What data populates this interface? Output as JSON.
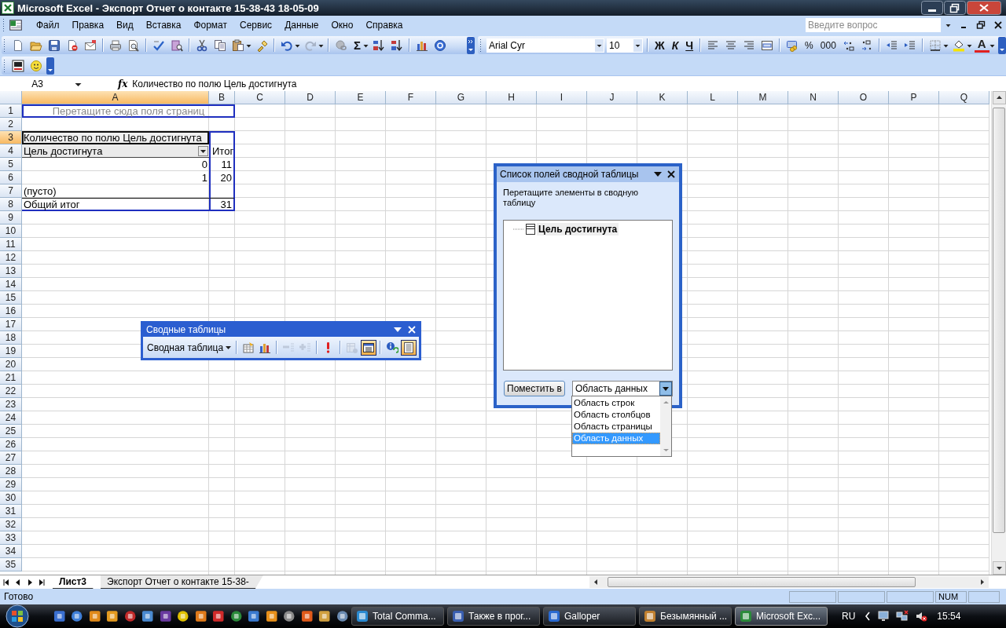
{
  "window": {
    "title": "Microsoft Excel - Экспорт Отчет о контакте 15-38-43 18-05-09"
  },
  "menu": [
    "Файл",
    "Правка",
    "Вид",
    "Вставка",
    "Формат",
    "Сервис",
    "Данные",
    "Окно",
    "Справка"
  ],
  "help_search": {
    "placeholder": "Введите вопрос"
  },
  "standard_toolbar": {
    "sum": "Σ"
  },
  "formatting_toolbar": {
    "font": "Arial Cyr",
    "size": "10",
    "bold": "Ж",
    "italic": "К",
    "underline": "Ч",
    "percent": "%",
    "thousands": "000",
    "font_color": "A"
  },
  "formula_bar": {
    "name_box": "A3",
    "fx": "fx",
    "formula": "Количество по полю Цель достигнута"
  },
  "columns": [
    {
      "label": "A",
      "selected": true
    },
    {
      "label": "B",
      "selected": false
    },
    {
      "label": "C",
      "selected": false
    },
    {
      "label": "D",
      "selected": false
    },
    {
      "label": "E",
      "selected": false
    },
    {
      "label": "F",
      "selected": false
    },
    {
      "label": "G",
      "selected": false
    },
    {
      "label": "H",
      "selected": false
    },
    {
      "label": "I",
      "selected": false
    },
    {
      "label": "J",
      "selected": false
    },
    {
      "label": "K",
      "selected": false
    },
    {
      "label": "L",
      "selected": false
    },
    {
      "label": "M",
      "selected": false
    },
    {
      "label": "N",
      "selected": false
    },
    {
      "label": "O",
      "selected": false
    },
    {
      "label": "P",
      "selected": false
    },
    {
      "label": "Q",
      "selected": false
    }
  ],
  "rows": [
    {
      "header": "1",
      "selected": false,
      "a": {
        "text": "Перетащите сюда поля страниц",
        "kind": "hint"
      }
    },
    {
      "header": "2",
      "selected": false
    },
    {
      "header": "3",
      "selected": true,
      "in_pivot": true,
      "a": {
        "text": "Количество по полю Цель достигнута",
        "kind": "caption"
      }
    },
    {
      "header": "4",
      "selected": false,
      "in_pivot": true,
      "a": {
        "text": "Цель достигнута",
        "kind": "field"
      },
      "b": {
        "text": "Итог",
        "kind": "label"
      }
    },
    {
      "header": "5",
      "selected": false,
      "in_pivot": true,
      "a": {
        "text": "0",
        "kind": "number"
      },
      "b": {
        "text": "11",
        "kind": "number"
      }
    },
    {
      "header": "6",
      "selected": false,
      "in_pivot": true,
      "a": {
        "text": "1",
        "kind": "number"
      },
      "b": {
        "text": "20",
        "kind": "number"
      }
    },
    {
      "header": "7",
      "selected": false,
      "in_pivot": true,
      "a": {
        "text": "(пусто)",
        "kind": "label"
      }
    },
    {
      "header": "8",
      "selected": false,
      "in_pivot": true,
      "total": true,
      "a": {
        "text": "Общий итог",
        "kind": "label"
      },
      "b": {
        "text": "31",
        "kind": "number"
      }
    },
    {
      "header": "9",
      "selected": false
    },
    {
      "header": "10",
      "selected": false
    },
    {
      "header": "11",
      "selected": false
    },
    {
      "header": "12",
      "selected": false
    },
    {
      "header": "13",
      "selected": false
    },
    {
      "header": "14",
      "selected": false
    },
    {
      "header": "15",
      "selected": false
    },
    {
      "header": "16",
      "selected": false
    },
    {
      "header": "17",
      "selected": false
    },
    {
      "header": "18",
      "selected": false
    },
    {
      "header": "19",
      "selected": false
    },
    {
      "header": "20",
      "selected": false
    },
    {
      "header": "21",
      "selected": false
    },
    {
      "header": "22",
      "selected": false
    },
    {
      "header": "23",
      "selected": false
    },
    {
      "header": "24",
      "selected": false
    },
    {
      "header": "25",
      "selected": false
    },
    {
      "header": "26",
      "selected": false
    },
    {
      "header": "27",
      "selected": false
    },
    {
      "header": "28",
      "selected": false
    },
    {
      "header": "29",
      "selected": false
    },
    {
      "header": "30",
      "selected": false
    },
    {
      "header": "31",
      "selected": false
    },
    {
      "header": "32",
      "selected": false
    },
    {
      "header": "33",
      "selected": false
    },
    {
      "header": "34",
      "selected": false
    },
    {
      "header": "35",
      "selected": false
    }
  ],
  "pivot_toolbar": {
    "title": "Сводные таблицы",
    "menu": "Сводная таблица",
    "tools": [
      {
        "pressed": false,
        "disabled": false
      },
      {
        "pressed": false,
        "disabled": false
      },
      {
        "pressed": false,
        "disabled": true
      },
      {
        "pressed": false,
        "disabled": true
      },
      {
        "pressed": false,
        "disabled": false
      },
      {
        "pressed": false,
        "disabled": true
      },
      {
        "pressed": true,
        "disabled": false
      },
      {
        "pressed": false,
        "disabled": false
      },
      {
        "pressed": true,
        "disabled": false
      }
    ]
  },
  "field_list": {
    "title": "Список полей сводной таблицы",
    "instruction": "Перетащите элементы в сводную таблицу",
    "fields": [
      "Цель достигнута"
    ],
    "button": "Поместить в",
    "area": {
      "value": "Область данных",
      "expanded": true
    },
    "options": [
      {
        "label": "Область строк",
        "selected": false
      },
      {
        "label": "Область столбцов",
        "selected": false
      },
      {
        "label": "Область страницы",
        "selected": false
      },
      {
        "label": "Область данных",
        "selected": true
      }
    ]
  },
  "sheet_tabs": [
    {
      "label": "Лист3",
      "selected": true
    },
    {
      "label": "Экспорт Отчет о контакте 15-38-",
      "selected": false
    }
  ],
  "status_bar": {
    "text": "Готово",
    "indicators": [
      "NUM"
    ]
  },
  "taskbar": {
    "tasks": [
      {
        "label": "Total Comma...",
        "selected": false
      },
      {
        "label": "Также в прог...",
        "selected": false
      },
      {
        "label": "Galloper",
        "selected": false
      },
      {
        "label": "Безымянный ...",
        "selected": false
      },
      {
        "label": "Microsoft Exc...",
        "selected": true
      }
    ],
    "language": "RU",
    "clock": "15:54"
  }
}
